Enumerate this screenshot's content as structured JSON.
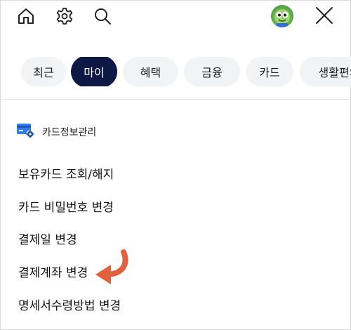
{
  "header": {
    "icons": [
      "home-icon",
      "gear-icon",
      "search-icon",
      "avatar",
      "close-icon"
    ]
  },
  "tabs": [
    {
      "label": "최근",
      "active": false
    },
    {
      "label": "마이",
      "active": true
    },
    {
      "label": "혜택",
      "active": false
    },
    {
      "label": "금융",
      "active": false
    },
    {
      "label": "카드",
      "active": false
    },
    {
      "label": "생활편의",
      "active": false
    }
  ],
  "section": {
    "title": "카드정보관리",
    "icon": "card-settings-icon",
    "items": [
      "보유카드 조회/해지",
      "카드 비밀번호 변경",
      "결제일 변경",
      "결제계좌 변경",
      "명세서수령방법 변경"
    ]
  },
  "colors": {
    "active_tab_bg": "#0e1845",
    "tab_bg": "#f2f3f5",
    "card_icon_blue": "#2f7ef0",
    "arrow": "#e0623d"
  },
  "annotation": {
    "type": "curved-arrow",
    "points_to": "결제계좌 변경"
  }
}
